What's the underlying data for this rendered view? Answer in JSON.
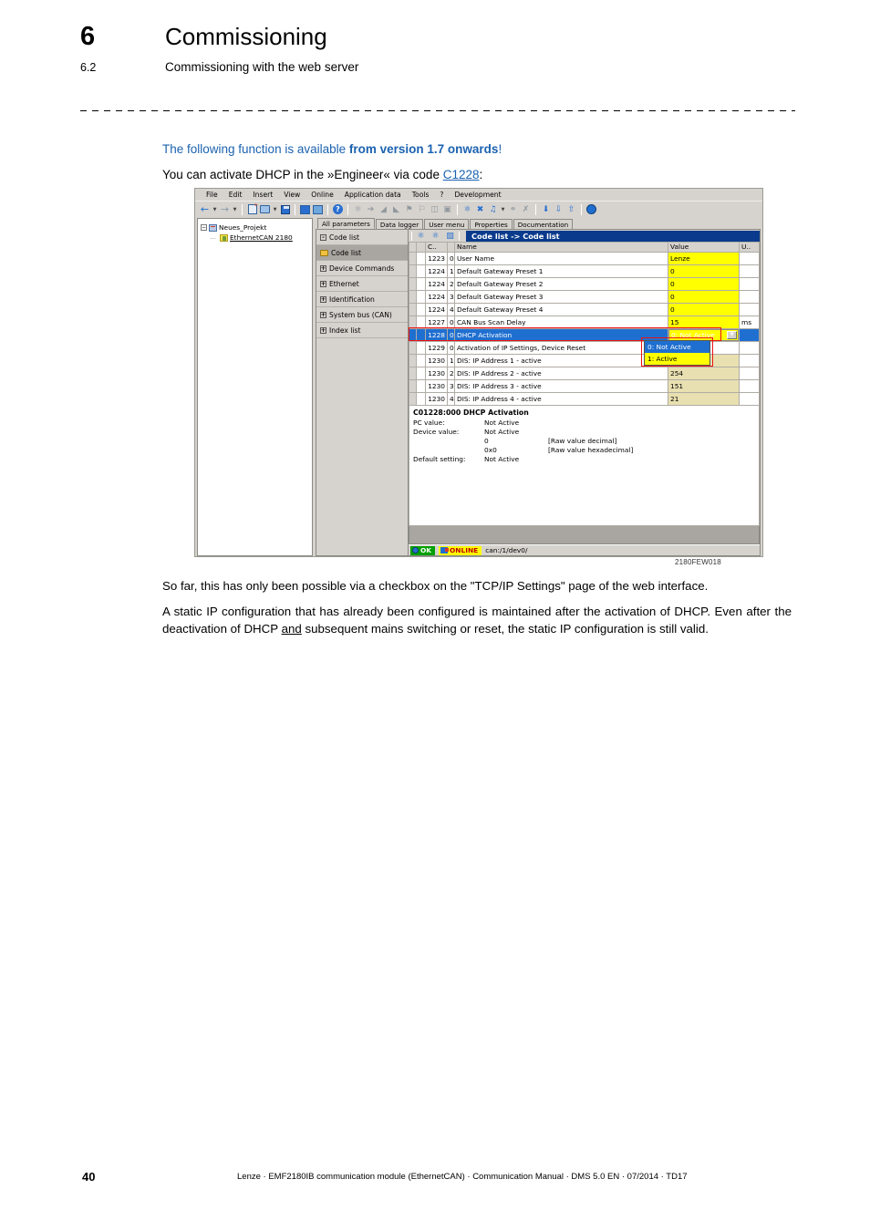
{
  "header": {
    "chapter_number": "6",
    "chapter_title": "Commissioning",
    "section_number": "6.2",
    "section_title": "Commissioning with the web server"
  },
  "note": {
    "text_plain": "The following function is available ",
    "text_bold": "from version 1.7 onwards",
    "text_end": "!"
  },
  "lead": {
    "before": "You can activate DHCP in the »Engineer« via code ",
    "link": "C1228",
    "after": ":"
  },
  "figure": {
    "caption": "2180FEW018",
    "menubar": [
      {
        "label": "File"
      },
      {
        "label": "Edit"
      },
      {
        "label": "Insert"
      },
      {
        "label": "View"
      },
      {
        "label": "Online"
      },
      {
        "label": "Application data"
      },
      {
        "label": "Tools"
      },
      {
        "label": "?"
      },
      {
        "label": "Development"
      }
    ],
    "tree": {
      "root": "Neues_Projekt",
      "child": "EthernetCAN 2180"
    },
    "tabs": [
      {
        "label": "All parameters",
        "active": true
      },
      {
        "label": "Data logger",
        "active": false
      },
      {
        "label": "User menu",
        "active": false
      },
      {
        "label": "Properties",
        "active": false
      },
      {
        "label": "Documentation",
        "active": false
      }
    ],
    "nav_items": [
      {
        "label": "Code list",
        "expander": "-",
        "selected": false,
        "folder": false
      },
      {
        "label": "Code list",
        "expander": "",
        "selected": true,
        "folder": true
      },
      {
        "label": "Device Commands",
        "expander": "+",
        "selected": false,
        "folder": false
      },
      {
        "label": "Ethernet",
        "expander": "+",
        "selected": false,
        "folder": false
      },
      {
        "label": "Identification",
        "expander": "+",
        "selected": false,
        "folder": false
      },
      {
        "label": "System bus (CAN)",
        "expander": "+",
        "selected": false,
        "folder": false
      },
      {
        "label": "Index list",
        "expander": "+",
        "selected": false,
        "folder": false
      }
    ],
    "grid_title": "Code list -> Code list",
    "columns": {
      "sort_a": "",
      "code": "C..",
      "sort_b": "",
      "name": "Name",
      "value": "Value",
      "unit": "U.."
    },
    "rows": [
      {
        "code": "1223",
        "sub": "0",
        "name": "User Name",
        "value": "Lenze",
        "unit": "",
        "value_style": "yellow",
        "selected": false
      },
      {
        "code": "1224",
        "sub": "1",
        "name": "Default Gateway Preset 1",
        "value": "0",
        "unit": "",
        "value_style": "yellow",
        "selected": false
      },
      {
        "code": "1224",
        "sub": "2",
        "name": "Default Gateway Preset 2",
        "value": "0",
        "unit": "",
        "value_style": "yellow",
        "selected": false
      },
      {
        "code": "1224",
        "sub": "3",
        "name": "Default Gateway Preset 3",
        "value": "0",
        "unit": "",
        "value_style": "yellow",
        "selected": false
      },
      {
        "code": "1224",
        "sub": "4",
        "name": "Default Gateway Preset 4",
        "value": "0",
        "unit": "",
        "value_style": "yellow",
        "selected": false
      },
      {
        "code": "1227",
        "sub": "0",
        "name": "CAN Bus Scan Delay",
        "value": "15",
        "unit": "ms",
        "value_style": "yellow",
        "selected": false
      },
      {
        "code": "1228",
        "sub": "0",
        "name": "DHCP Activation",
        "value": "",
        "unit": "",
        "value_style": "dropdown",
        "selected": true
      },
      {
        "code": "1229",
        "sub": "0",
        "name": "Activation of IP Settings, Device Reset",
        "value": "",
        "unit": "",
        "value_style": "plain",
        "selected": false
      },
      {
        "code": "1230",
        "sub": "1",
        "name": "DIS: IP Address 1 - active",
        "value": "",
        "unit": "",
        "value_style": "tan",
        "selected": false
      },
      {
        "code": "1230",
        "sub": "2",
        "name": "DIS: IP Address 2 - active",
        "value": "254",
        "unit": "",
        "value_style": "tan",
        "selected": false
      },
      {
        "code": "1230",
        "sub": "3",
        "name": "DIS: IP Address 3 - active",
        "value": "151",
        "unit": "",
        "value_style": "tan",
        "selected": false
      },
      {
        "code": "1230",
        "sub": "4",
        "name": "DIS: IP Address 4 - active",
        "value": "21",
        "unit": "",
        "value_style": "tan",
        "selected": false
      }
    ],
    "dropdown": {
      "selected_value": "0:   Not Active",
      "options": [
        {
          "label": "0:   Not Active",
          "highlighted": true
        },
        {
          "label": "1:   Active",
          "highlighted": false
        }
      ]
    },
    "detail": {
      "title": "C01228:000 DHCP Activation",
      "pc_value_label": "PC value:",
      "pc_value": "Not Active",
      "device_value_label": "Device value:",
      "device_value": "Not Active",
      "raw_decimal": "0",
      "raw_decimal_note": "[Raw value decimal]",
      "raw_hex": "0x0",
      "raw_hex_note": "[Raw value hexadecimal]",
      "default_label": "Default setting:",
      "default_value": "Not Active"
    },
    "statusbar": {
      "ok_label": "OK",
      "online_label": "ONLINE",
      "path": "can:/1/dev0/"
    }
  },
  "paragraphs": {
    "p1": "So far, this has only been possible via a checkbox on the \"TCP/IP Settings\" page of the web interface.",
    "p2_before": "A static IP configuration that has already been configured is maintained after the activation of DHCP. Even after the deactivation of DHCP ",
    "p2_underline": "and",
    "p2_after": " subsequent mains switching or reset, the static IP configuration is still valid."
  },
  "footer": {
    "page_number": "40",
    "text": "Lenze · EMF2180IB communication module (EthernetCAN) · Communication Manual · DMS 5.0 EN · 07/2014 · TD17"
  },
  "colors": {
    "accent_blue": "#1b62b0",
    "title_bar_blue": "#0a3a8c",
    "selection_blue": "#1f6fd0",
    "value_yellow": "#ffff00",
    "value_tan": "#e8e0b0",
    "highlight_red": "#ee1111",
    "status_green": "#00a000"
  }
}
